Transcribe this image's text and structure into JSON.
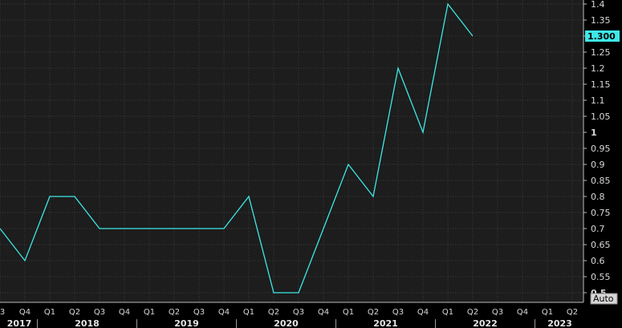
{
  "chart_data": {
    "type": "line",
    "x": [
      "2017 Q3",
      "2017 Q4",
      "2018 Q1",
      "2018 Q2",
      "2018 Q3",
      "2018 Q4",
      "2019 Q1",
      "2019 Q2",
      "2019 Q3",
      "2019 Q4",
      "2020 Q1",
      "2020 Q2",
      "2020 Q3",
      "2020 Q4",
      "2021 Q1",
      "2021 Q2",
      "2021 Q3",
      "2021 Q4",
      "2022 Q1",
      "2022 Q2"
    ],
    "series": [
      {
        "values": [
          0.7,
          0.6,
          0.8,
          0.8,
          0.7,
          0.7,
          0.7,
          0.7,
          0.7,
          0.7,
          0.8,
          0.5,
          0.5,
          0.7,
          0.9,
          0.8,
          1.2,
          1.0,
          1.4,
          1.3
        ],
        "color": "#3ee8e8"
      }
    ],
    "ylim": [
      0.475,
      1.41
    ],
    "y_ticks": [
      "0.5",
      "0.55",
      "0.6",
      "0.65",
      "0.7",
      "0.75",
      "0.8",
      "0.85",
      "0.9",
      "0.95",
      "1",
      "1.05",
      "1.1",
      "1.15",
      "1.2",
      "1.25",
      "1.3",
      "1.35",
      "1.4"
    ],
    "x_tick_labels": [
      "3",
      "Q4",
      "Q1",
      "Q2",
      "Q3",
      "Q4",
      "Q1",
      "Q2",
      "Q3",
      "Q4",
      "Q1",
      "Q2",
      "Q3",
      "Q4",
      "Q1",
      "Q2",
      "Q3",
      "Q4",
      "Q1",
      "Q2",
      "Q3",
      "Q4",
      "Q1",
      "Q2"
    ],
    "years": [
      "2017",
      "2018",
      "2019",
      "2020",
      "2021",
      "2022",
      "2023"
    ],
    "last_value_label": "1.300",
    "scale_mode": "Auto",
    "grid": true,
    "colors": {
      "background": "#000000",
      "plot_bg": "#1c1d1c",
      "grid": "#3a3b3a",
      "line": "#3ee8e8",
      "badge": "#3ee8e8"
    }
  }
}
